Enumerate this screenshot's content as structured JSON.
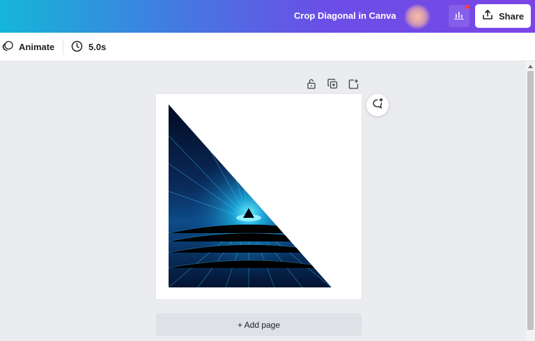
{
  "header": {
    "doc_title": "Crop Diagonal in Canva",
    "share_label": "Share",
    "insights_icon": "bar-chart-icon",
    "share_icon": "upload-icon",
    "notification_color": "#ff3b3b"
  },
  "toolbar": {
    "animate_label": "Animate",
    "duration_label": "5.0s",
    "animate_icon": "animate-icon",
    "duration_icon": "clock-icon"
  },
  "page_actions": {
    "lock_icon": "lock-icon",
    "duplicate_icon": "duplicate-icon",
    "add_page_icon": "add-page-icon"
  },
  "canvas": {
    "image_description_icon": "triangle-crop-image",
    "comment_icon": "comment-add-icon"
  },
  "footer": {
    "add_page_label": "+ Add page"
  },
  "colors": {
    "header_gradient_start": "#15b6d8",
    "header_gradient_end": "#7a45e6",
    "workspace_bg": "#ebecf0"
  }
}
